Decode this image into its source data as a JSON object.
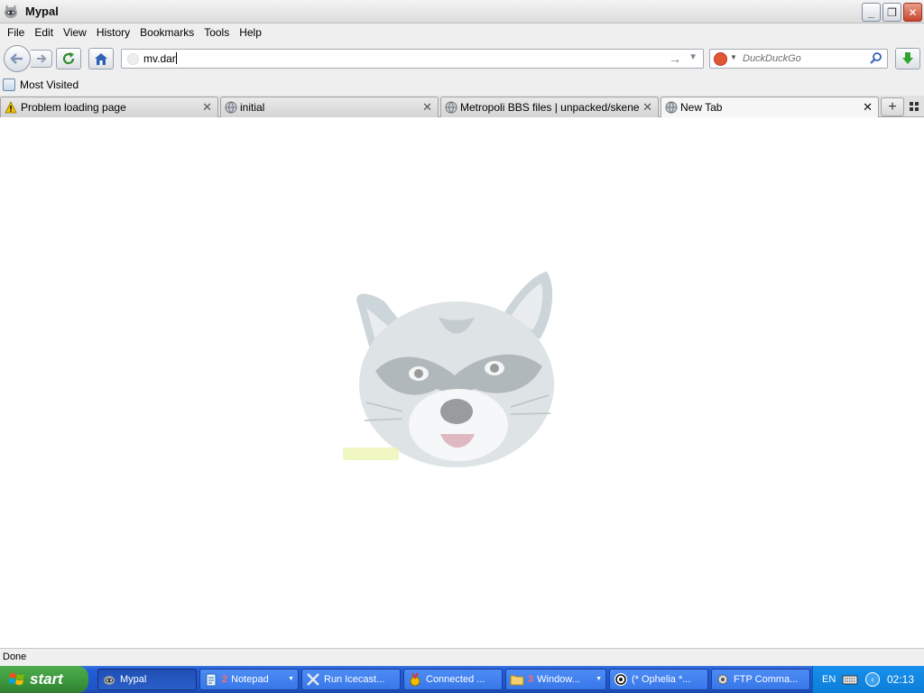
{
  "window": {
    "title": "Mypal",
    "minimize_label": "_",
    "restore_label": "❐",
    "close_label": "✕"
  },
  "menu": {
    "items": [
      "File",
      "Edit",
      "View",
      "History",
      "Bookmarks",
      "Tools",
      "Help"
    ]
  },
  "navbar": {
    "url_value": "mv.dar",
    "search_placeholder": "DuckDuckGo"
  },
  "bookmarks": {
    "items": [
      {
        "label": "Most Visited"
      }
    ]
  },
  "tabs": [
    {
      "label": "Problem loading page",
      "icon": "warning-icon",
      "selected": false
    },
    {
      "label": "initial",
      "icon": "globe-icon",
      "selected": false
    },
    {
      "label": "Metropoli BBS files | unpacked/skene/m...",
      "icon": "globe-icon",
      "selected": false
    },
    {
      "label": "New Tab",
      "icon": "globe-icon",
      "selected": true
    }
  ],
  "tab_close_label": "✕",
  "new_tab_label": "+",
  "content": {
    "mascot_icon": "raccoon-logo"
  },
  "status": {
    "text": "Done"
  },
  "taskbar": {
    "start_label": "start",
    "tasks": [
      {
        "label": "Mypal",
        "icon": "mypal-icon",
        "active": true,
        "count": "",
        "has_dropdown": false
      },
      {
        "label": "Notepad",
        "icon": "notepad-icon",
        "active": false,
        "count": "2",
        "has_dropdown": true
      },
      {
        "label": "Run Icecast...",
        "icon": "tools-icon",
        "active": false,
        "count": "",
        "has_dropdown": false
      },
      {
        "label": "Connected ...",
        "icon": "medal-icon",
        "active": false,
        "count": "",
        "has_dropdown": false
      },
      {
        "label": "Window...",
        "icon": "folder-icon",
        "active": false,
        "count": "3",
        "has_dropdown": true
      },
      {
        "label": "(* Ophelia *...",
        "icon": "at-icon",
        "active": false,
        "count": "",
        "has_dropdown": false
      },
      {
        "label": "FTP Comma...",
        "icon": "gear-icon",
        "active": false,
        "count": "",
        "has_dropdown": false
      }
    ],
    "tray": {
      "language": "EN",
      "clock": "02:13"
    }
  },
  "colors": {
    "taskbar_blue": "#245edb",
    "start_green": "#3c963c",
    "tray_blue": "#0d7ed8"
  }
}
